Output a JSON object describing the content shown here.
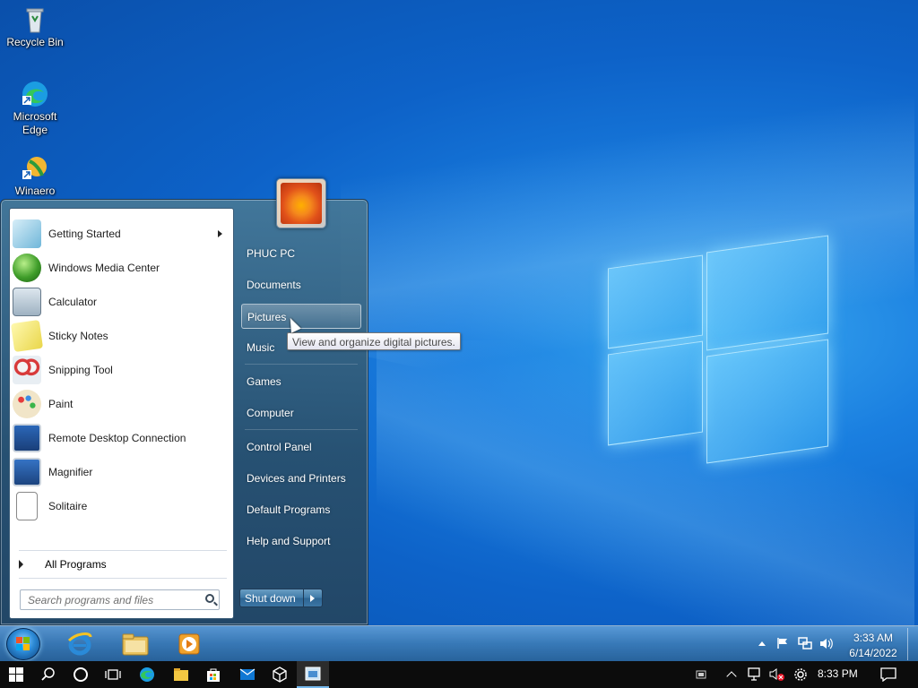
{
  "desktop": {
    "icons": [
      {
        "label": "Recycle Bin",
        "icon": "recycle-bin-icon"
      },
      {
        "label": "Microsoft Edge",
        "icon": "edge-icon"
      },
      {
        "label": "Winaero",
        "icon": "winaero-icon"
      }
    ]
  },
  "start_menu": {
    "programs": [
      {
        "label": "Getting Started",
        "icon": "getting-started-icon",
        "has_submenu": true
      },
      {
        "label": "Windows Media Center",
        "icon": "media-center-icon"
      },
      {
        "label": "Calculator",
        "icon": "calculator-icon"
      },
      {
        "label": "Sticky Notes",
        "icon": "sticky-notes-icon"
      },
      {
        "label": "Snipping Tool",
        "icon": "snipping-tool-icon"
      },
      {
        "label": "Paint",
        "icon": "paint-icon"
      },
      {
        "label": "Remote Desktop Connection",
        "icon": "remote-desktop-icon"
      },
      {
        "label": "Magnifier",
        "icon": "magnifier-icon"
      },
      {
        "label": "Solitaire",
        "icon": "solitaire-icon"
      }
    ],
    "all_programs": "All Programs",
    "search_placeholder": "Search programs and files",
    "right_items": [
      "PHUC PC",
      "Documents",
      "Pictures",
      "Music",
      "Games",
      "Computer",
      "Control Panel",
      "Devices and Printers",
      "Default Programs",
      "Help and Support"
    ],
    "hovered_item": "Pictures",
    "tooltip": "View and organize digital pictures.",
    "shutdown_label": "Shut down"
  },
  "taskbar7": {
    "clock_time": "3:33 AM",
    "clock_date": "6/14/2022"
  },
  "taskbar10": {
    "clock_time": "8:33 PM"
  },
  "colors": {
    "desktop_blue": "#0d62c8",
    "accent_light": "#76b9ed"
  }
}
